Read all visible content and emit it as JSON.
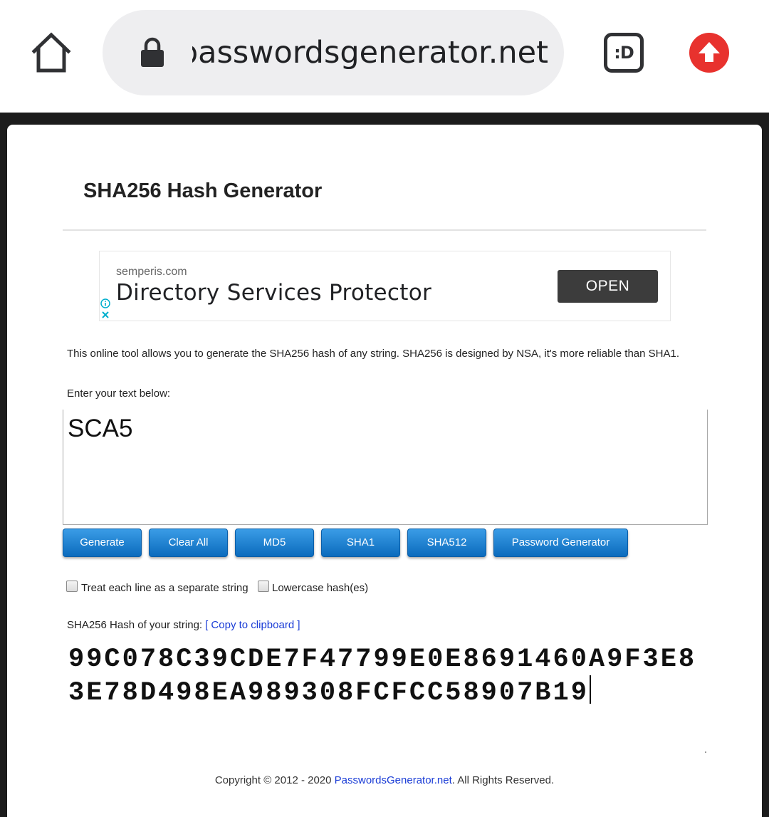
{
  "browser": {
    "url": "passwordsgenerator.net",
    "extension_label": ":D",
    "colors": {
      "update": "#e8322e",
      "url_pill": "#eeeef0"
    }
  },
  "page": {
    "title": "SHA256 Hash Generator",
    "description": "This online tool allows you to generate the SHA256 hash of any string. SHA256 is designed by NSA, it's more reliable than SHA1.",
    "prompt": "Enter your text below:",
    "input_text": "SCA5"
  },
  "ad": {
    "domain": "semperis.com",
    "headline": "Directory Services Protector",
    "cta": "OPEN"
  },
  "buttons": {
    "generate": "Generate",
    "clear_all": "Clear All",
    "md5": "MD5",
    "sha1": "SHA1",
    "sha512": "SHA512",
    "password_generator": "Password Generator"
  },
  "options": {
    "separate_lines": {
      "label": "Treat each line as a separate string",
      "checked": false
    },
    "lowercase": {
      "label": "Lowercase hash(es)",
      "checked": false
    }
  },
  "result": {
    "label": "SHA256 Hash of your string:",
    "copy_link": "[ Copy to clipboard ]",
    "hash": "99C078C39CDE7F47799E0E8691460A9F3E83E78D498EA989308FCFCC58907B19"
  },
  "footer": {
    "prefix": "Copyright © 2012 - 2020 ",
    "link": "PasswordsGenerator.net",
    "suffix": ". All Rights Reserved."
  },
  "theme": {
    "button_blue": "#1a7fd0",
    "link_blue": "#1a3cd6"
  }
}
